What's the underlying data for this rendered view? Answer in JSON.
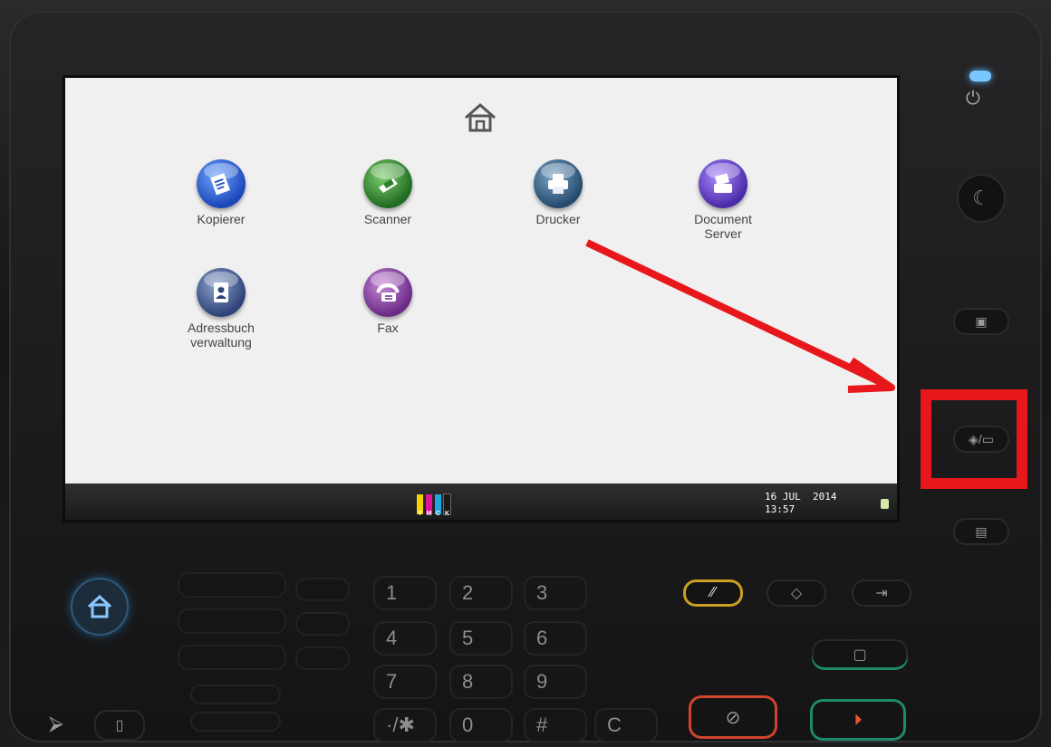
{
  "screen": {
    "apps": [
      {
        "label_line1": "Kopierer",
        "label_line2": "",
        "icon": "copier-icon"
      },
      {
        "label_line1": "Scanner",
        "label_line2": "",
        "icon": "scanner-icon"
      },
      {
        "label_line1": "Drucker",
        "label_line2": "",
        "icon": "printer-icon"
      },
      {
        "label_line1": "Document",
        "label_line2": "Server",
        "icon": "document-server-icon"
      },
      {
        "label_line1": "Adressbuch",
        "label_line2": "verwaltung",
        "icon": "address-book-icon"
      },
      {
        "label_line1": "Fax",
        "label_line2": "",
        "icon": "fax-icon"
      }
    ],
    "status": {
      "toner_labels": [
        "Y",
        "M",
        "C",
        "K"
      ],
      "toner_colors": [
        "#f2d300",
        "#e2139a",
        "#1ba7e0",
        "#1a1a1a"
      ],
      "date": "16 JUL  2014",
      "time": "13:57"
    }
  },
  "keypad": {
    "keys": [
      "1",
      "2",
      "3",
      "4",
      "5",
      "6",
      "7",
      "8",
      "9",
      "·/✱",
      "0",
      "#",
      "C"
    ]
  },
  "colors": {
    "annotation": "#e8171b",
    "led": "#79c7ff"
  }
}
